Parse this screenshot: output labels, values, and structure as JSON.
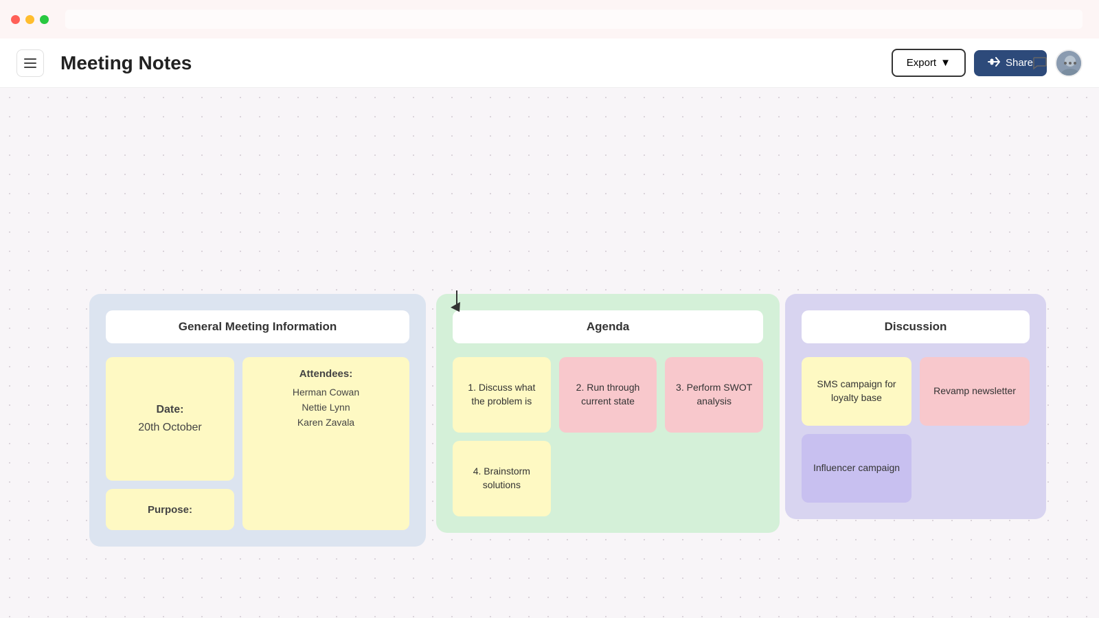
{
  "titlebar": {
    "traffic_lights": [
      "red",
      "yellow",
      "green"
    ]
  },
  "toolbar": {
    "menu_icon": "☰",
    "title": "Meeting Notes",
    "export_label": "Export",
    "export_arrow": "▼",
    "share_label": "Share",
    "share_icon": "👥"
  },
  "cards": {
    "meeting": {
      "header": "General Meeting Information",
      "date_label": "Date:",
      "date_value": "20th October",
      "purpose_label": "Purpose:",
      "attendees_title": "Attendees:",
      "attendees": [
        "Herman Cowan",
        "Nettie Lynn",
        "Karen Zavala"
      ]
    },
    "agenda": {
      "header": "Agenda",
      "items": [
        "1. Discuss what the problem is",
        "2. Run through current state",
        "3. Perform SWOT analysis",
        "4. Brainstorm solutions"
      ]
    },
    "discussion": {
      "header": "Discussion",
      "items": [
        "SMS campaign for loyalty base",
        "Revamp newsletter",
        "Influencer campaign"
      ]
    }
  },
  "cursor": {
    "visible": true
  }
}
